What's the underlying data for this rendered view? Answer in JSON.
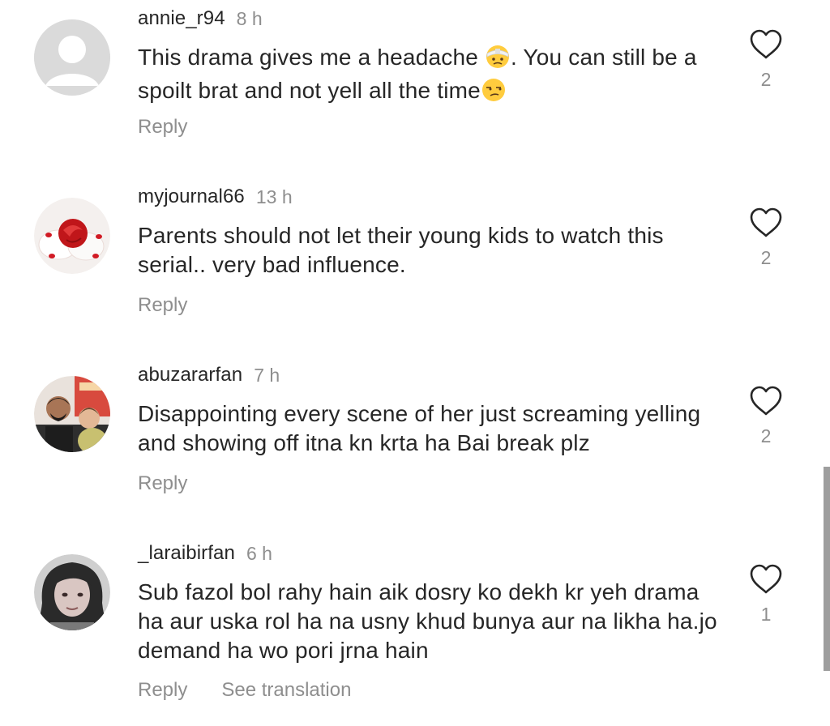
{
  "comments": [
    {
      "username": "annie_r94",
      "time": "8 h",
      "text_before": "This drama gives me a headache ",
      "emoji_1": "face-with-head-bandage",
      "text_middle": ". You can still be a spoilt brat and not yell all the time",
      "emoji_2": "unamused-face",
      "text_after": "",
      "likes": "2",
      "reply_label": "Reply"
    },
    {
      "username": "myjournal66",
      "time": "13 h",
      "text": "Parents should not let their young kids to watch this serial.. very bad influence.",
      "likes": "2",
      "reply_label": "Reply"
    },
    {
      "username": "abuzararfan",
      "time": "7 h",
      "text": "Disappointing every scene of her just screaming yelling and showing off itna kn krta ha Bai break plz",
      "likes": "2",
      "reply_label": "Reply"
    },
    {
      "username": "_laraibirfan",
      "time": "6 h",
      "text": "Sub fazol bol rahy hain aik dosry ko dekh kr yeh drama ha aur uska rol ha na usny khud bunya aur na likha ha.jo demand ha wo pori jrna hain",
      "likes": "1",
      "reply_label": "Reply",
      "translate_label": "See translation"
    }
  ],
  "icons": {
    "like": "heart-outline-icon"
  },
  "colors": {
    "text": "#262626",
    "secondary": "#8e8e8e",
    "background": "#ffffff"
  }
}
